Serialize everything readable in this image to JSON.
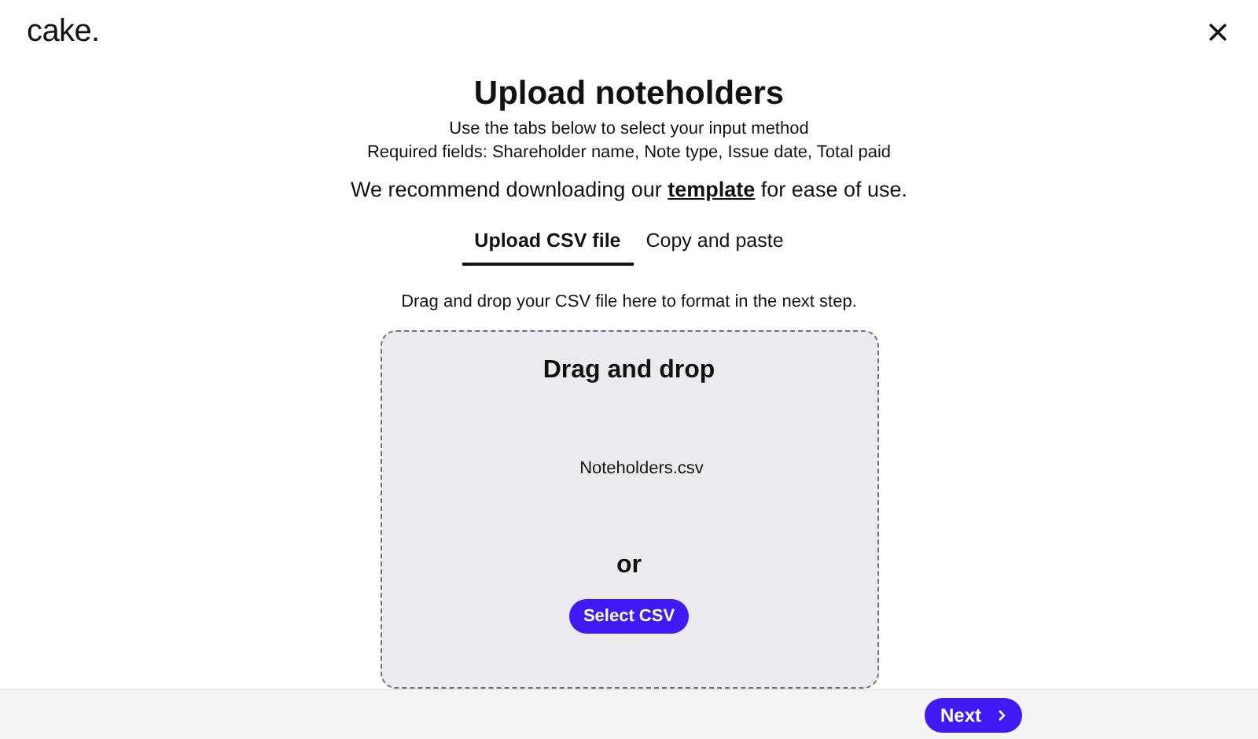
{
  "header": {
    "logo": "cake."
  },
  "title": "Upload noteholders",
  "instructions": [
    "Use the tabs below to select your input method",
    "Required fields: Shareholder name, Note type, Issue date, Total paid"
  ],
  "recommend": {
    "before": "We recommend downloading our",
    "link": "template",
    "after": "for ease of use."
  },
  "tabs": [
    {
      "label": "Upload CSV file",
      "selected": true
    },
    {
      "label": "Copy and paste",
      "selected": false
    }
  ],
  "hint": "Drag and drop your CSV file here to format in the next step.",
  "drop_zone": {
    "title": "Drag and drop",
    "file": "Noteholders.csv",
    "separator": "or",
    "button": "Select CSV"
  },
  "footer": {
    "next": "Next"
  }
}
